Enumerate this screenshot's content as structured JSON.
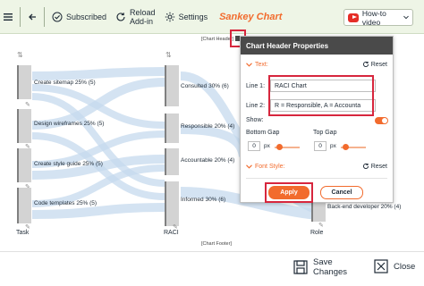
{
  "toolbar": {
    "subscribed": "Subscribed",
    "reload_line1": "Reload",
    "reload_line2": "Add-in",
    "settings": "Settings",
    "title": "Sankey Chart",
    "how_to_video": "How-to video"
  },
  "chart": {
    "header_label": "[Chart Header]",
    "footer_label": "[Chart Footer]",
    "axis_labels": [
      "Task",
      "RACI",
      "Role"
    ],
    "task_nodes": [
      "Create sitemap 25% (5)",
      "Design wireframes 25% (5)",
      "Create style guide 25% (5)",
      "Code templates 25% (5)"
    ],
    "raci_nodes": [
      "Consulted 30% (6)",
      "Responsible 20% (4)",
      "Accountable 20% (4)",
      "Informed 30% (6)"
    ],
    "role_nodes": [
      "Back-end developer 20% (4)"
    ]
  },
  "panel": {
    "title": "Chart Header Properties",
    "text_section": "Text:",
    "reset": "Reset",
    "line1_label": "Line 1:",
    "line1_value": "RACI Chart",
    "line2_label": "Line 2:",
    "line2_value": "R = Responsible, A = Accounta",
    "show_label": "Show:",
    "bottom_gap_label": "Bottom Gap",
    "bottom_gap_value": "0",
    "top_gap_label": "Top Gap",
    "top_gap_value": "0",
    "px": "px",
    "font_style_section": "Font Style:",
    "apply": "Apply",
    "cancel": "Cancel"
  },
  "bottom": {
    "save_line1": "Save",
    "save_line2": "Changes",
    "close": "Close"
  },
  "colors": {
    "accent": "#f26b2d",
    "toolbar_bg": "#eef5e6",
    "highlight": "#d7263d",
    "flow": "#c5d9ee"
  }
}
